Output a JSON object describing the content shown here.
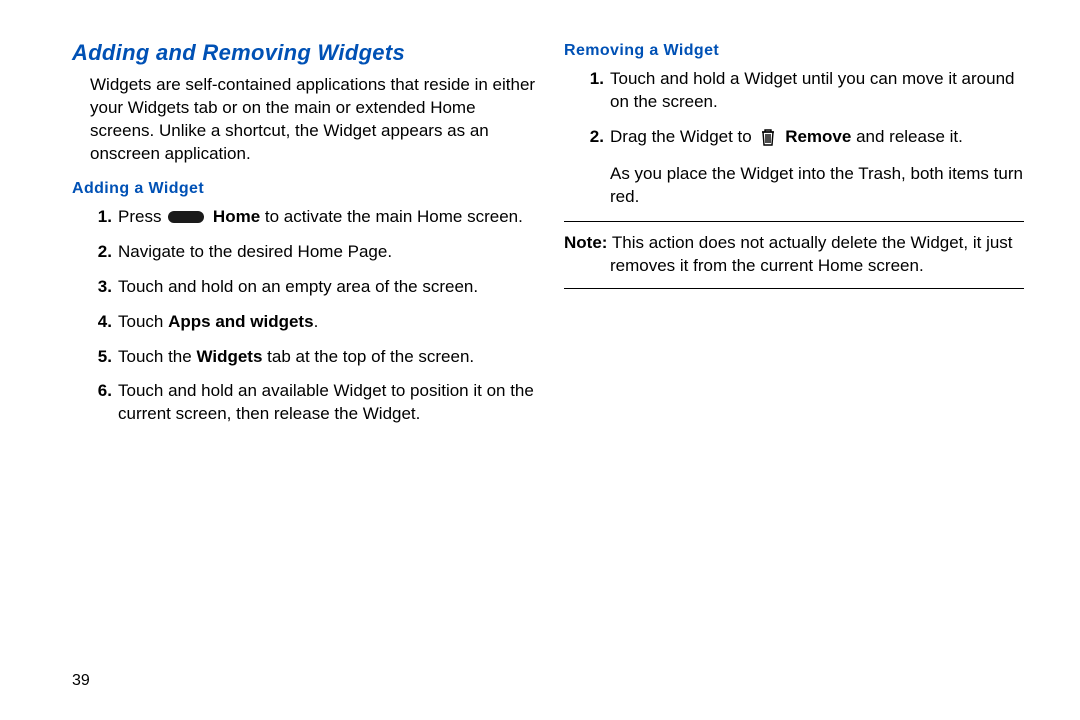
{
  "page_number": "39",
  "left": {
    "section_title": "Adding and Removing Widgets",
    "intro": "Widgets are self-contained applications that reside in either your Widgets tab or on the main or extended Home screens. Unlike a shortcut, the Widget appears as an onscreen application.",
    "sub_heading": "Adding a Widget",
    "steps": {
      "s1_pre": "Press ",
      "s1_bold": " Home",
      "s1_post": " to activate the main Home screen.",
      "s2": "Navigate to the desired Home Page.",
      "s3": "Touch and hold on an empty area of the screen.",
      "s4_pre": "Touch ",
      "s4_bold": "Apps and widgets",
      "s4_post": ".",
      "s5_pre": "Touch the ",
      "s5_bold": "Widgets",
      "s5_post": " tab at the top of the screen.",
      "s6": "Touch and hold an available Widget to position it on the current screen, then release the Widget."
    }
  },
  "right": {
    "sub_heading": "Removing a Widget",
    "steps": {
      "s1": "Touch and hold a Widget until you can move it around on the screen.",
      "s2_pre": "Drag the Widget to ",
      "s2_bold": " Remove",
      "s2_post": " and release it.",
      "s2_follow": "As you place the Widget into the Trash, both items turn red."
    },
    "note_label": "Note:",
    "note_text": " This action does not actually delete the Widget, it just removes it from the current Home screen."
  }
}
